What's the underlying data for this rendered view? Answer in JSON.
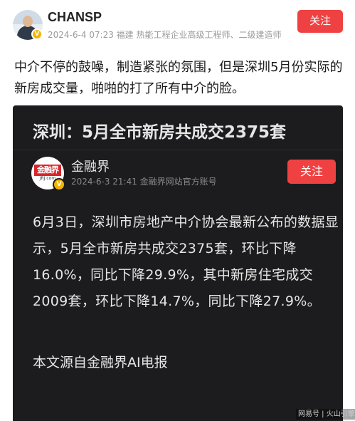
{
  "post": {
    "author": {
      "name": "CHANSP",
      "meta": "2024-6-4 07:23 福建 热能工程企业高级工程师、二级建造师"
    },
    "follow_label": "关注",
    "text": "中介不停的鼓噪，制造紧张的氛围，但是深圳5月份实际的新房成交量，啪啪的打了所有中介的脸。"
  },
  "embed": {
    "title": "深圳：5月全市新房共成交2375套",
    "source": {
      "name": "金融界",
      "meta": "2024-6-3  21:41  金融界网站官方账号",
      "logo_text": "金融界",
      "logo_sub": "JRJ.com"
    },
    "follow_label": "关注",
    "body": "6月3日，深圳市房地产中介协会最新公布的数据显示，5月全市新房共成交2375套，环比下降16.0%，同比下降29.9%，其中新房住宅成交2009套，环比下降14.7%，同比下降27.9%。",
    "footnote": "本文源自金融界AI电报"
  },
  "watermark": "网易号 | 火山引擎",
  "colors": {
    "accent": "#f04142",
    "embed_bg": "#1c1c1e",
    "badge": "#f5b400"
  }
}
